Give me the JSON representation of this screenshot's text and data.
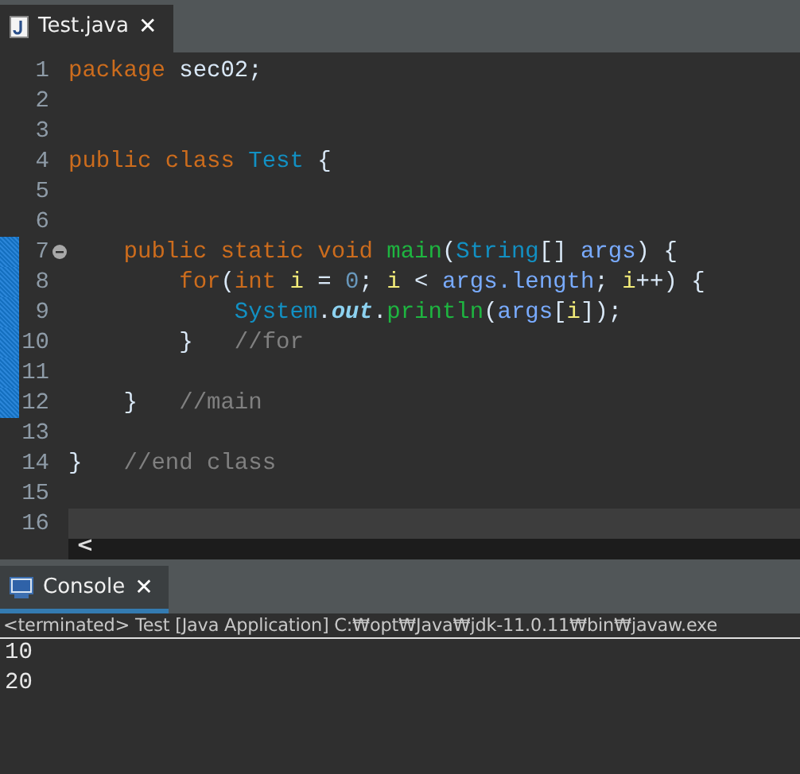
{
  "editor_tab": {
    "title": "Test.java",
    "close": "✕",
    "selected": true
  },
  "lines": [
    {
      "number": "1",
      "changed": false,
      "tokens": [
        {
          "kind": "keyword",
          "text": "package"
        },
        {
          "kind": "plain",
          "text": " sec02;"
        }
      ]
    },
    {
      "number": "2",
      "changed": false
    },
    {
      "number": "3",
      "changed": false
    },
    {
      "number": "4",
      "changed": false,
      "tokens": [
        {
          "kind": "keyword",
          "text": "public class"
        },
        {
          "kind": "type",
          "text": " Test"
        },
        {
          "kind": "plain",
          "text": " {"
        }
      ]
    },
    {
      "number": "5",
      "changed": false
    },
    {
      "number": "6",
      "changed": false
    },
    {
      "number": "7",
      "changed": true,
      "fold": true,
      "tokens": [
        {
          "kind": "keyword",
          "text": "    public static void"
        },
        {
          "kind": "method",
          "text": " main"
        },
        {
          "kind": "plain",
          "text": "("
        },
        {
          "kind": "type",
          "text": "String"
        },
        {
          "kind": "plain",
          "text": "[] "
        },
        {
          "kind": "param",
          "text": "args"
        },
        {
          "kind": "plain",
          "text": ") {"
        }
      ]
    },
    {
      "number": "8",
      "changed": true,
      "tokens": [
        {
          "kind": "keyword",
          "text": "        for"
        },
        {
          "kind": "plain",
          "text": "("
        },
        {
          "kind": "keyword",
          "text": "int"
        },
        {
          "kind": "variable",
          "text": " i"
        },
        {
          "kind": "plain",
          "text": " = "
        },
        {
          "kind": "number",
          "text": "0"
        },
        {
          "kind": "plain",
          "text": "; "
        },
        {
          "kind": "variable",
          "text": "i"
        },
        {
          "kind": "plain",
          "text": " < "
        },
        {
          "kind": "param",
          "text": "args.length"
        },
        {
          "kind": "plain",
          "text": "; "
        },
        {
          "kind": "variable",
          "text": "i"
        },
        {
          "kind": "plain",
          "text": "++) {"
        }
      ]
    },
    {
      "number": "9",
      "changed": true,
      "tokens": [
        {
          "kind": "type",
          "text": "            System"
        },
        {
          "kind": "plain",
          "text": "."
        },
        {
          "kind": "field",
          "text": "out"
        },
        {
          "kind": "plain",
          "text": "."
        },
        {
          "kind": "method",
          "text": "println"
        },
        {
          "kind": "plain",
          "text": "("
        },
        {
          "kind": "param",
          "text": "args"
        },
        {
          "kind": "plain",
          "text": "["
        },
        {
          "kind": "variable",
          "text": "i"
        },
        {
          "kind": "plain",
          "text": "]);"
        }
      ]
    },
    {
      "number": "10",
      "changed": true,
      "tokens": [
        {
          "kind": "plain",
          "text": "        }"
        },
        {
          "kind": "comment",
          "text": "   //for"
        }
      ]
    },
    {
      "number": "11",
      "changed": true
    },
    {
      "number": "12",
      "changed": true,
      "tokens": [
        {
          "kind": "plain",
          "text": "    }"
        },
        {
          "kind": "comment",
          "text": "   //main"
        }
      ]
    },
    {
      "number": "13",
      "changed": false
    },
    {
      "number": "14",
      "changed": false,
      "tokens": [
        {
          "kind": "plain",
          "text": "}"
        },
        {
          "kind": "comment",
          "text": "   //end class"
        }
      ]
    },
    {
      "number": "15",
      "changed": false
    },
    {
      "number": "16",
      "changed": false,
      "current": true
    }
  ],
  "scrollbar": {
    "left_arrow": "<"
  },
  "console_tab": {
    "title": "Console",
    "close": "✕",
    "selected": true
  },
  "console": {
    "status": "<terminated> Test [Java Application] C:₩opt₩Java₩jdk-11.0.11₩bin₩javaw.exe",
    "output": [
      "10",
      "20"
    ]
  }
}
